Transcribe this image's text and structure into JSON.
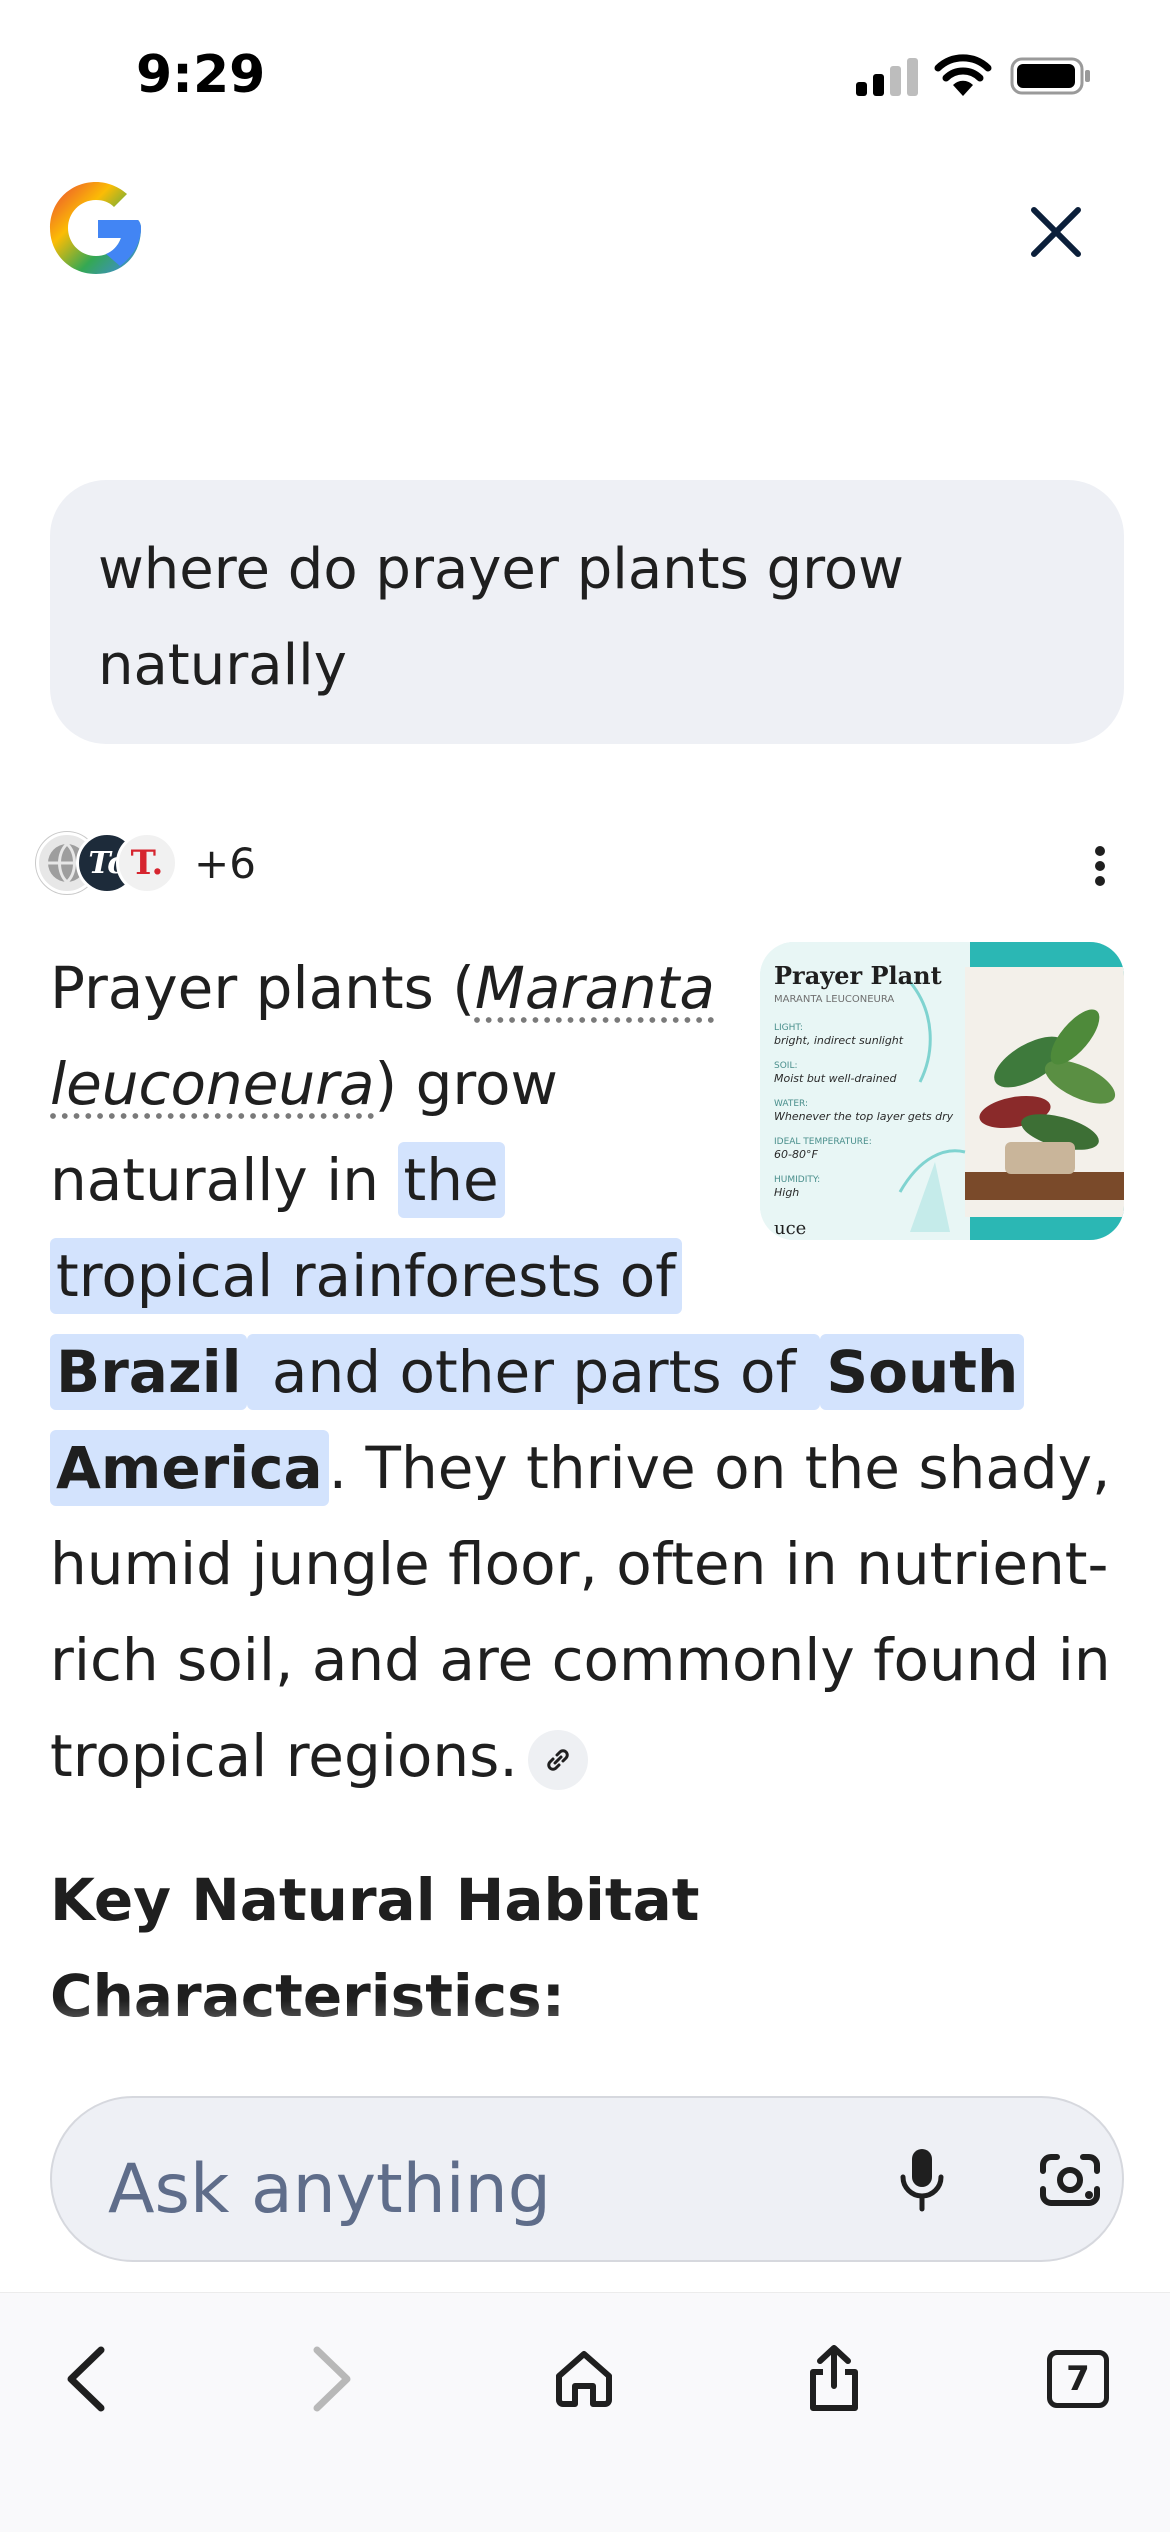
{
  "status_bar": {
    "time": "9:29"
  },
  "header": {
    "logo_icon": "google-g-logo",
    "close_icon": "close-icon"
  },
  "query": {
    "text": "where do prayer plants grow naturally"
  },
  "sources": {
    "more_count": "+6",
    "avatar_b_initials": "Tc",
    "avatar_c_initial": "T."
  },
  "answer": {
    "t1": "Prayer plants (",
    "sci_name": "Maranta leuconeura",
    "t2": ") grow naturally in ",
    "h1": "the tropical rainforests of ",
    "h2": "Brazil",
    "h3": " and other parts of ",
    "h4": "South America",
    "t3": ". They thrive on the shady, humid jungle floor, often in nutrient-rich soil, and are commonly found in tropical regions.",
    "image": {
      "title": "Prayer Plant",
      "subtitle": "MARANTA LEUCONEURA",
      "rows": [
        {
          "label": "LIGHT:",
          "value": "bright, indirect sunlight"
        },
        {
          "label": "SOIL:",
          "value": "Moist but well-drained"
        },
        {
          "label": "WATER:",
          "value": "Whenever the top layer gets dry"
        },
        {
          "label": "IDEAL TEMPERATURE:",
          "value": "60-80°F"
        },
        {
          "label": "HUMIDITY:",
          "value": "High"
        }
      ],
      "footer": "uce"
    }
  },
  "section": {
    "heading": "Key Natural Habitat Characteristics:"
  },
  "ask_bar": {
    "placeholder": "Ask anything"
  },
  "toolbar": {
    "tabs_count": "7"
  },
  "colors": {
    "highlight": "#d3e3fd",
    "bubble": "#eef0f5",
    "google_blue": "#4285f4",
    "google_red": "#ea4335",
    "google_yellow": "#fbbc05",
    "google_green": "#34a853"
  }
}
